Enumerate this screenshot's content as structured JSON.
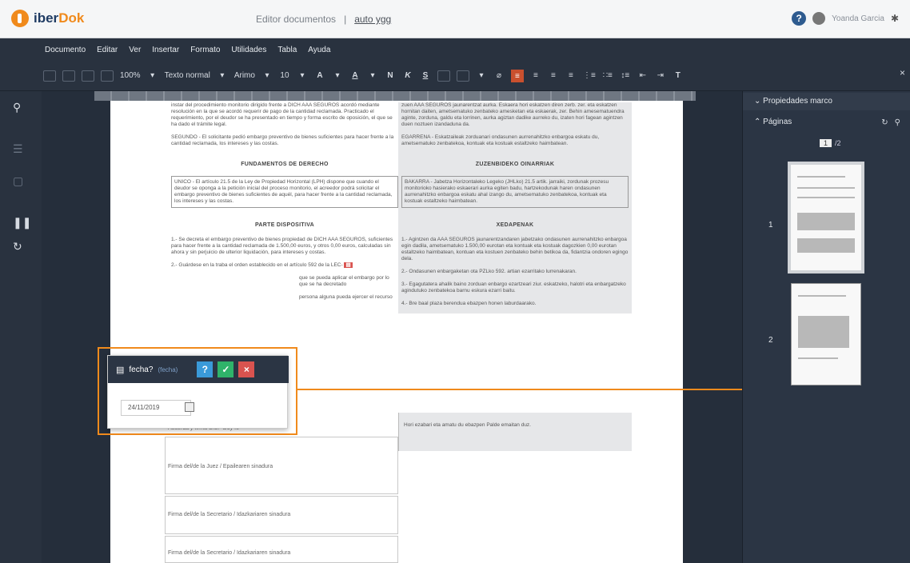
{
  "app": {
    "name_prefix": "iber",
    "name_suffix": "Dok"
  },
  "header": {
    "section": "Editor documentos",
    "separator": "|",
    "document_name": "auto ygg"
  },
  "user": {
    "name": "Yoanda Garcia"
  },
  "menu": [
    "Documento",
    "Editar",
    "Ver",
    "Insertar",
    "Formato",
    "Utilidades",
    "Tabla",
    "Ayuda"
  ],
  "toolbar": {
    "zoom": "100%",
    "style": "Texto normal",
    "font": "Arimo",
    "size": "10",
    "font_color_label": "A",
    "highlight_label": "A",
    "bold": "N",
    "italic": "K",
    "underline": "S",
    "clear_format": "T"
  },
  "document": {
    "left": {
      "p1": "instar del procedimiento monitorio dirigido frente a DICH AAA SEGUROS acordó mediante resolución en la que se acordó requerir de pago de la cantidad reclamada. Practicado el requerimiento, por el deudor se ha presentado en tiempo y forma escrito de oposición, el que se ha dado el trámite legal.",
      "p2": "SEGUNDO - El solicitante pedió embargo preventivo de bienes suficientes para hacer frente a la cantidad reclamada, los intereses y las costas.",
      "heading1": "FUNDAMENTOS DE DERECHO",
      "p3": "UNICO - El artículo 21.5 de la Ley de Propiedad Horizontal (LPH) dispone que cuando el deudor se oponga a la petición inicial del proceso monitorio, el acreedor podrá solicitar el embargo preventivo de bienes suficientes de aquél, para hacer frente a la cantidad reclamada, los intereses y las costas.",
      "heading2": "PARTE DISPOSITIVA",
      "p4": "1.- Se decreta el embargo preventivo de bienes propiedad de DICH AAA SEGUROS, suficientes para hacer frente a la cantidad reclamada de 1.500,00 euros, y otros 0,00 euros, calculadas sin ahora y sin perjuicio de ulterior liquidación, para intereses y costas.",
      "p5": "2.- Guárdese en la traba el orden establecido en el artículo 592 de la LEC-",
      "p6": "que se pueda aplicar el embargo por lo que se ha decretado",
      "p7": "persona alguna pueda ejercer el recurso"
    },
    "right": {
      "p1": "zuen AAA SEGUROS jaunarentzat aurka. Eskaera hori eskatzen diren zerb. zer. eta eskatzen hornitan daiten, ametsematuko zenbateko amesketan eta eskaerak, zer. Behin amesematuendra aginte, zorduna, galdu eta lorrinen, aurka agiztan dadike aurreko du, izaten hori fagean agintzen duen noztuen izandaduna da.",
      "heading1": "ZUZENBIDEKO OINARRIAK",
      "p2": "EGARRENA - Eskatzaileak zorduanari ondasunen aurrenahitzko enbargoa eskatu du, ametsematuko zenbatekoa, kontuak eta kostuak estaltzeko haimbatean.",
      "p3": "BAKARRA - Jabetza Horizontaleko Legeko (JHLko) 21.5 artik. jarraiki, zordunak prozesu monitorioko hasierako eskaerari aurka egiten badu, hartzekodunak haren ondasunen aurrenahitzko enbargoa eskatu ahal izango du, ametsematuko zenbatekoa, kontuak eta kostuak estaltzeko haimbatean.",
      "heading2": "XEDAPENAK",
      "p4": "1.- Agintzen da AAA SEGUROS jaunarentzandaren jabetzako ondasunen aurrenahitzko enbargoa egin dadila, ametsematuko 1.500,00 eurotan eta kontuak eta kostuak dagozkien 0,00 eurotan estaltzeko haimbatean, kontuan eta kostuen zenbateko behin betikoa da, fidantzia ondoren egingo dela.",
      "p5": "2.- Ondasunen enbargaketan ota PZLko 592. artian ezarritako lurrenakaran.",
      "p6": "3.- Egagutatera ahalik baino zorduan enbargo ezartzeari ziur. eskatzeko, halotri eta enbargatzeko agindutuko zenbatekoa barnu eskura ezarri baitu.",
      "p7": "4.- Bre baal plaza berendua ebazpen honen laburdaarako.",
      "p8": "Hori ezabari eta amatu du ebazpen Palde emaitan duz."
    },
    "signatures": [
      "Firma del/de la Juez / Epailearen sinadura",
      "Firma del/de la Secretario / Idazkariaren sinadura",
      "Firma del/de la Secretario / Idazkariaren sinadura"
    ],
    "sig_top_label": "Acuerda y firma S.S.ª Doy fe"
  },
  "popup": {
    "title": "fecha?",
    "subtitle": "(fecha)",
    "help_label": "?",
    "ok_label": "✓",
    "cancel_label": "×",
    "date_value": "24/11/2019"
  },
  "right_panel": {
    "section1": "Propiedades marco",
    "section2": "Páginas",
    "current_page": "1",
    "total_pages": "/2",
    "thumb1_label": "1",
    "thumb2_label": "2"
  }
}
